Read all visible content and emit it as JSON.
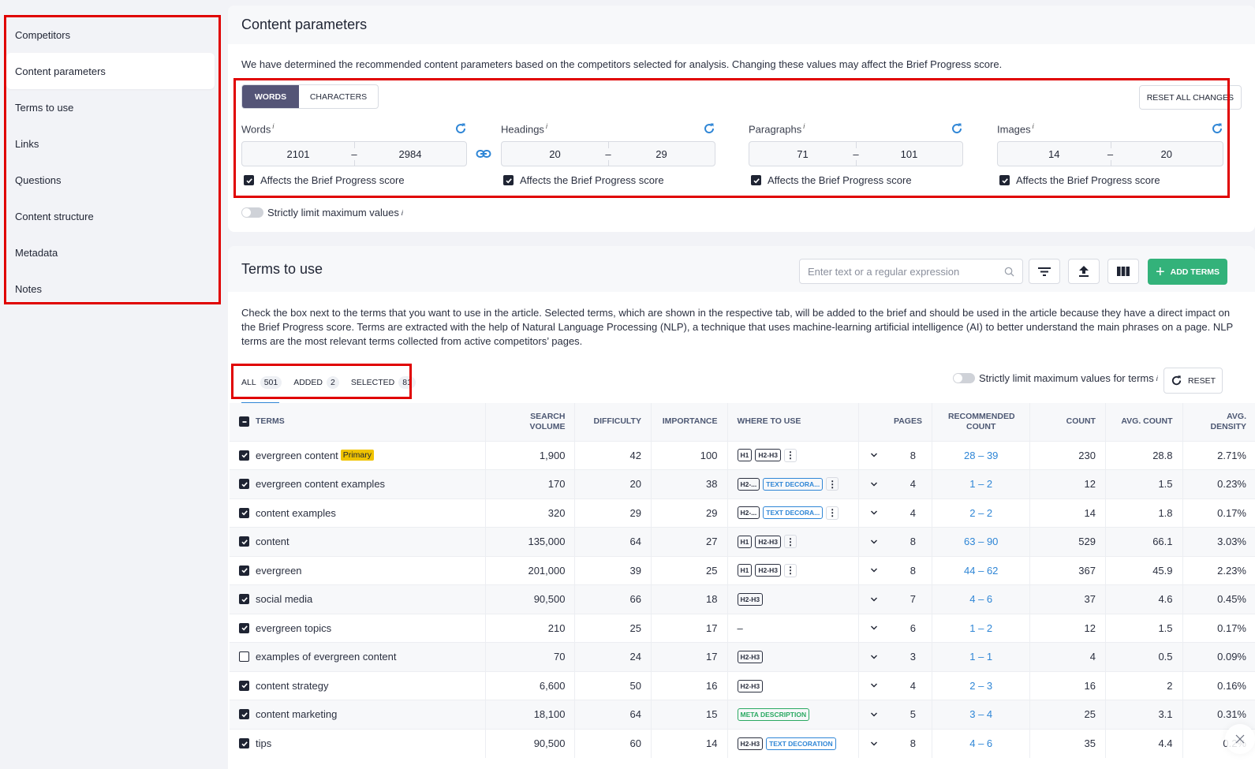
{
  "sidebar": {
    "items": [
      {
        "label": "Competitors",
        "active": false
      },
      {
        "label": "Content parameters",
        "active": true
      },
      {
        "label": "Terms to use",
        "active": false
      },
      {
        "label": "Links",
        "active": false
      },
      {
        "label": "Questions",
        "active": false
      },
      {
        "label": "Content structure",
        "active": false
      },
      {
        "label": "Metadata",
        "active": false
      },
      {
        "label": "Notes",
        "active": false
      }
    ]
  },
  "content_parameters": {
    "title": "Content parameters",
    "description": "We have determined the recommended content parameters based on the competitors selected for analysis. Changing these values may affect the Brief Progress score.",
    "mode_toggle": {
      "words": "WORDS",
      "characters": "CHARACTERS",
      "selected": "WORDS"
    },
    "reset_all_label": "RESET ALL CHANGES",
    "info_glyph": "i",
    "affects_label": "Affects the Brief Progress score",
    "params": [
      {
        "label": "Words",
        "min": "2101",
        "max": "2984",
        "affects": true
      },
      {
        "label": "Headings",
        "min": "20",
        "max": "29",
        "affects": true
      },
      {
        "label": "Paragraphs",
        "min": "71",
        "max": "101",
        "affects": true
      },
      {
        "label": "Images",
        "min": "14",
        "max": "20",
        "affects": true
      }
    ],
    "range_separator": "–",
    "strict_limit_label": "Strictly limit maximum values",
    "strict_limit_on": false
  },
  "terms": {
    "title": "Terms to use",
    "search_placeholder": "Enter text or a regular expression",
    "search_value": "",
    "add_terms_label": "ADD TERMS",
    "description": "Check the box next to the terms that you want to use in the article. Selected terms, which are shown in the respective tab, will be added to the brief and should be used in the article because they have a direct impact on the Brief Progress score. Terms are extracted with the help of Natural Language Processing (NLP), a technique that uses machine-learning artificial intelligence (AI) to better understand the main phrases on a page. NLP terms are the most relevant terms collected from active competitors’ pages.",
    "tabs": [
      {
        "label": "ALL",
        "count": "501",
        "active": true
      },
      {
        "label": "ADDED",
        "count": "2",
        "active": false
      },
      {
        "label": "SELECTED",
        "count": "81",
        "active": false
      }
    ],
    "strict_terms_label": "Strictly limit maximum values for terms",
    "strict_terms_on": false,
    "reset_label": "RESET",
    "primary_badge": "Primary",
    "columns": [
      "TERMS",
      "SEARCH VOLUME",
      "DIFFICULTY",
      "IMPORTANCE",
      "WHERE TO USE",
      "PAGES",
      "RECOMMENDED COUNT",
      "COUNT",
      "AVG. COUNT",
      "AVG. DENSITY"
    ],
    "rows": [
      {
        "term": "evergreen content",
        "primary": true,
        "checked": true,
        "volume": "1,900",
        "difficulty": "42",
        "importance": "100",
        "where": [
          {
            "t": "H1",
            "c": "dark"
          },
          {
            "t": "H2-H3",
            "c": "dark"
          }
        ],
        "more": true,
        "pages": "8",
        "rec": "28 – 39",
        "count": "230",
        "avg_count": "28.8",
        "avg_density": "2.71%"
      },
      {
        "term": "evergreen content examples",
        "primary": false,
        "checked": true,
        "volume": "170",
        "difficulty": "20",
        "importance": "38",
        "where": [
          {
            "t": "H2-...",
            "c": "dark"
          },
          {
            "t": "TEXT DECORA...",
            "c": "blue"
          }
        ],
        "more": true,
        "pages": "4",
        "rec": "1 – 2",
        "count": "12",
        "avg_count": "1.5",
        "avg_density": "0.23%"
      },
      {
        "term": "content examples",
        "primary": false,
        "checked": true,
        "volume": "320",
        "difficulty": "29",
        "importance": "29",
        "where": [
          {
            "t": "H2-...",
            "c": "dark"
          },
          {
            "t": "TEXT DECORA...",
            "c": "blue"
          }
        ],
        "more": true,
        "pages": "4",
        "rec": "2 – 2",
        "count": "14",
        "avg_count": "1.8",
        "avg_density": "0.17%"
      },
      {
        "term": "content",
        "primary": false,
        "checked": true,
        "volume": "135,000",
        "difficulty": "64",
        "importance": "27",
        "where": [
          {
            "t": "H1",
            "c": "dark"
          },
          {
            "t": "H2-H3",
            "c": "dark"
          }
        ],
        "more": true,
        "pages": "8",
        "rec": "63 – 90",
        "count": "529",
        "avg_count": "66.1",
        "avg_density": "3.03%"
      },
      {
        "term": "evergreen",
        "primary": false,
        "checked": true,
        "volume": "201,000",
        "difficulty": "39",
        "importance": "25",
        "where": [
          {
            "t": "H1",
            "c": "dark"
          },
          {
            "t": "H2-H3",
            "c": "dark"
          }
        ],
        "more": true,
        "pages": "8",
        "rec": "44 – 62",
        "count": "367",
        "avg_count": "45.9",
        "avg_density": "2.23%"
      },
      {
        "term": "social media",
        "primary": false,
        "checked": true,
        "volume": "90,500",
        "difficulty": "66",
        "importance": "18",
        "where": [
          {
            "t": "H2-H3",
            "c": "dark"
          }
        ],
        "more": false,
        "pages": "7",
        "rec": "4 – 6",
        "count": "37",
        "avg_count": "4.6",
        "avg_density": "0.45%"
      },
      {
        "term": "evergreen topics",
        "primary": false,
        "checked": true,
        "volume": "210",
        "difficulty": "25",
        "importance": "17",
        "where": [],
        "none_label": "–",
        "more": false,
        "pages": "6",
        "rec": "1 – 2",
        "count": "12",
        "avg_count": "1.5",
        "avg_density": "0.17%"
      },
      {
        "term": "examples of evergreen content",
        "primary": false,
        "checked": false,
        "volume": "70",
        "difficulty": "24",
        "importance": "17",
        "where": [
          {
            "t": "H2-H3",
            "c": "dark"
          }
        ],
        "more": false,
        "pages": "3",
        "rec": "1 – 1",
        "count": "4",
        "avg_count": "0.5",
        "avg_density": "0.09%"
      },
      {
        "term": "content strategy",
        "primary": false,
        "checked": true,
        "volume": "6,600",
        "difficulty": "50",
        "importance": "16",
        "where": [
          {
            "t": "H2-H3",
            "c": "dark"
          }
        ],
        "more": false,
        "pages": "4",
        "rec": "2 – 3",
        "count": "16",
        "avg_count": "2",
        "avg_density": "0.16%"
      },
      {
        "term": "content marketing",
        "primary": false,
        "checked": true,
        "volume": "18,100",
        "difficulty": "64",
        "importance": "15",
        "where": [
          {
            "t": "META DESCRIPTION",
            "c": "green"
          }
        ],
        "more": false,
        "pages": "5",
        "rec": "3 – 4",
        "count": "25",
        "avg_count": "3.1",
        "avg_density": "0.31%"
      },
      {
        "term": "tips",
        "primary": false,
        "checked": true,
        "volume": "90,500",
        "difficulty": "60",
        "importance": "14",
        "where": [
          {
            "t": "H2-H3",
            "c": "dark"
          },
          {
            "t": "TEXT DECORATION",
            "c": "blue"
          }
        ],
        "more": false,
        "pages": "8",
        "rec": "4 – 6",
        "count": "35",
        "avg_count": "4.4",
        "avg_density": "0.2%"
      }
    ]
  },
  "colors": {
    "accent_blue": "#2f86d6",
    "add_green": "#33b27a",
    "toggle_selected": "#545577",
    "primary_badge": "#f0c300",
    "annotation_red": "#e00000"
  }
}
